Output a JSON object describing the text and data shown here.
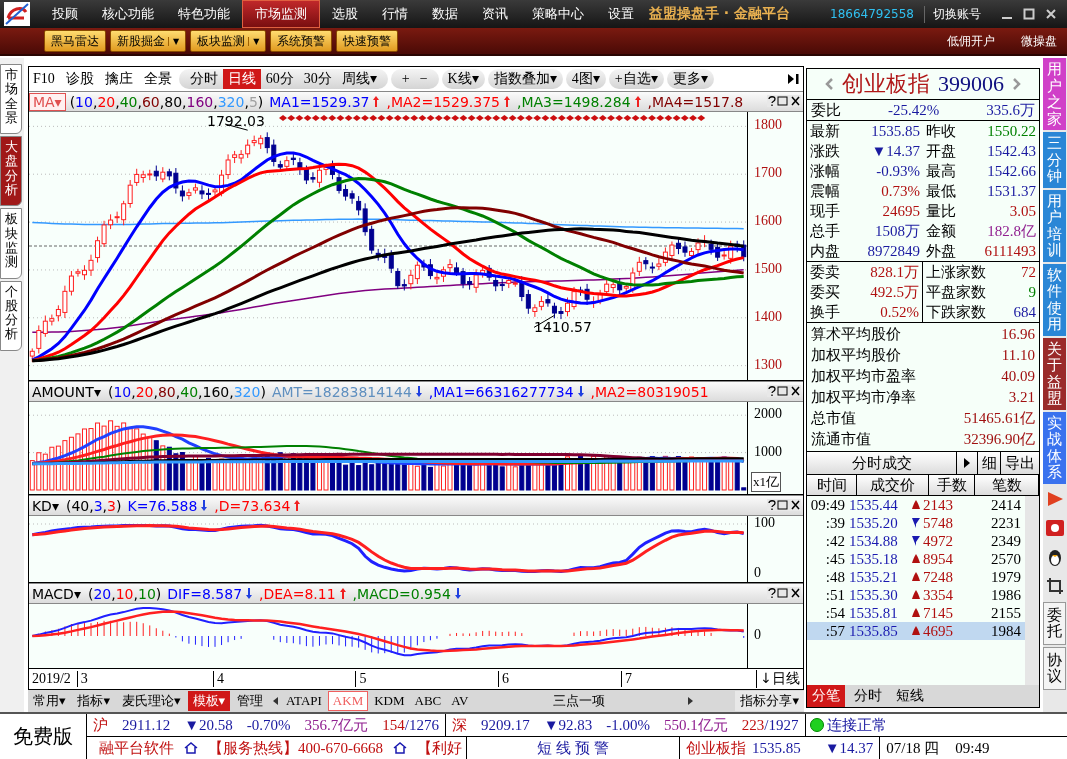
{
  "menu": {
    "items": [
      {
        "label": "投顾",
        "selected": false
      },
      {
        "label": "核心功能",
        "selected": false
      },
      {
        "label": "特色功能",
        "selected": false
      },
      {
        "label": "市场监测",
        "selected": true
      },
      {
        "label": "选股",
        "selected": false
      },
      {
        "label": "行情",
        "selected": false
      },
      {
        "label": "数据",
        "selected": false
      },
      {
        "label": "资讯",
        "selected": false
      },
      {
        "label": "策略中心",
        "selected": false
      },
      {
        "label": "设置",
        "selected": false
      }
    ],
    "brand": "益盟操盘手 · 金融平台",
    "phone": "18664792558",
    "switch_account": "切换账号"
  },
  "toolbar": {
    "buttons": [
      {
        "label": "黑马雷达"
      },
      {
        "label": "新股掘金",
        "caret": "▼"
      },
      {
        "label": "板块监测",
        "caret": "▼"
      },
      {
        "label": "系统预警"
      },
      {
        "label": "快速预警"
      }
    ],
    "links": [
      "低佣开户",
      "微操盘"
    ]
  },
  "left_tabs": [
    {
      "label": "市场全景",
      "selected": false
    },
    {
      "label": "大盘分析",
      "selected": true
    },
    {
      "label": "板块监测",
      "selected": false
    },
    {
      "label": "个股分析",
      "selected": false
    }
  ],
  "chart_toolbar": {
    "tools": [
      "F10",
      "诊股",
      "擒庄",
      "全景"
    ],
    "periods": [
      {
        "label": "分时",
        "selected": false
      },
      {
        "label": "日线",
        "selected": true
      },
      {
        "label": "60分",
        "selected": false
      },
      {
        "label": "30分",
        "selected": false
      },
      {
        "label": "周线",
        "selected": false,
        "caret": "▾"
      }
    ],
    "zoom": [
      "+",
      "−"
    ],
    "menus": [
      {
        "label": "K线",
        "caret": "▾"
      },
      {
        "label": "指数叠加",
        "caret": "▾"
      },
      {
        "label": "4图",
        "caret": "▾"
      },
      {
        "label": "+自选",
        "caret": "▾"
      },
      {
        "label": "更多",
        "caret": "▾"
      }
    ]
  },
  "panes": [
    {
      "kind": "price",
      "name": "MA",
      "caret": "▾",
      "open": "(",
      "sep": ",",
      "close": ")",
      "params": [
        {
          "text": "10",
          "color": "#0000ff"
        },
        {
          "text": "20",
          "color": "#ff0000"
        },
        {
          "text": "40",
          "color": "#008000"
        },
        {
          "text": "60",
          "color": "#800000"
        },
        {
          "text": "80",
          "color": "#000000"
        },
        {
          "text": "160",
          "color": "#800080"
        },
        {
          "text": "320",
          "color": "#3399ff"
        },
        {
          "text": "5",
          "color": "#a0a0a0"
        }
      ],
      "values": [
        {
          "text": "MA1=1529.37",
          "color": "#0000ff",
          "rising": true
        },
        {
          "text": ",MA2=1529.375",
          "color": "#ff0000",
          "rising": true
        },
        {
          "text": ",MA3=1498.284",
          "color": "#008000",
          "rising": true
        },
        {
          "text": ",MA4=1517.8",
          "color": "#800000"
        }
      ],
      "axis": [
        "1800",
        "1700",
        "1600",
        "1500",
        "1400",
        "1300"
      ],
      "high_label": "1792.03",
      "low_label": "1410.57"
    },
    {
      "kind": "amount",
      "name": "AMOUNT",
      "caret": "▾",
      "open": "(",
      "sep": ",",
      "close": ")",
      "params": [
        {
          "text": "10",
          "color": "#0000ff"
        },
        {
          "text": "20",
          "color": "#ff0000"
        },
        {
          "text": "80",
          "color": "#800000"
        },
        {
          "text": "40",
          "color": "#008000"
        },
        {
          "text": "160",
          "color": "#000000"
        },
        {
          "text": "320",
          "color": "#3399ff"
        }
      ],
      "values": [
        {
          "text": "AMT=18283814144",
          "color": "#5f8fbf",
          "rising": false
        },
        {
          "text": ",MA1=66316277734",
          "color": "#0000ff",
          "rising": false
        },
        {
          "text": ",MA2=80319051",
          "color": "#ff0000"
        }
      ],
      "axis": [
        "2000",
        "1000"
      ],
      "unit": "x1亿"
    },
    {
      "kind": "kd",
      "name": "KD",
      "caret": "▾",
      "open": "(",
      "sep": ",",
      "close": ")",
      "params": [
        {
          "text": "40",
          "color": "#000000"
        },
        {
          "text": "3",
          "color": "#0000ff"
        },
        {
          "text": "3",
          "color": "#ff0000"
        }
      ],
      "values": [
        {
          "text": "K=76.588",
          "color": "#0000ff",
          "rising": false
        },
        {
          "text": ",D=73.634",
          "color": "#ff0000",
          "rising": true
        }
      ],
      "axis": [
        "100",
        "0"
      ]
    },
    {
      "kind": "macd",
      "name": "MACD",
      "caret": "▾",
      "open": "(",
      "sep": ",",
      "close": ")",
      "params": [
        {
          "text": "20",
          "color": "#0000ff"
        },
        {
          "text": "10",
          "color": "#ff0000"
        },
        {
          "text": "10",
          "color": "#008000"
        }
      ],
      "values": [
        {
          "text": "DIF=8.587",
          "color": "#0000ff",
          "rising": false
        },
        {
          "text": ",DEA=8.11",
          "color": "#ff0000",
          "rising": true
        },
        {
          "text": ",MACD=0.954",
          "color": "#008000",
          "rising": false
        }
      ],
      "axis": [
        "0"
      ]
    }
  ],
  "dates": [
    "2019/2",
    "3",
    "4",
    "5",
    "6",
    "7"
  ],
  "period_label": "↓日线",
  "bottom_tabs": [
    {
      "label": "常用",
      "caret": "▾",
      "selected": false
    },
    {
      "label": "指标",
      "caret": "▾",
      "selected": false
    },
    {
      "label": "麦氏理论",
      "caret": "▾",
      "selected": false
    },
    {
      "label": "模板",
      "caret": "▾",
      "selected": true
    },
    {
      "label": "管理",
      "selected": false
    }
  ],
  "indicator_tabs": [
    {
      "label": "ATAPI",
      "selected": false
    },
    {
      "label": "AKM",
      "selected": true
    },
    {
      "label": "KDM",
      "selected": false
    },
    {
      "label": "ABC",
      "selected": false
    },
    {
      "label": "AV",
      "selected": false
    }
  ],
  "indicator_center": "三点一项",
  "indicator_share": {
    "label": "指标分享",
    "caret": "▾"
  },
  "quote": {
    "name": "创业板指",
    "code": "399006",
    "ratio_label": "委比",
    "ratio": "-25.42%",
    "ratio_amount": "335.6万",
    "grid": [
      {
        "label": "最新",
        "value": "1535.85",
        "color": "#1a1aa0"
      },
      {
        "label": "昨收",
        "value": "1550.22",
        "color": "#008000"
      },
      {
        "label": "涨跌",
        "value": "▼14.37",
        "color": "#1a1aa0"
      },
      {
        "label": "开盘",
        "value": "1542.43",
        "color": "#1a1aa0"
      },
      {
        "label": "涨幅",
        "value": "-0.93%",
        "color": "#1a1aa0"
      },
      {
        "label": "最高",
        "value": "1542.66",
        "color": "#1a1aa0"
      },
      {
        "label": "震幅",
        "value": "0.73%",
        "color": "#b01010"
      },
      {
        "label": "最低",
        "value": "1531.37",
        "color": "#1a1aa0"
      },
      {
        "label": "现手",
        "value": "24695",
        "color": "#b01010"
      },
      {
        "label": "量比",
        "value": "3.05",
        "color": "#b01010"
      },
      {
        "label": "总手",
        "value": "1508万",
        "color": "#1a1aa0"
      },
      {
        "label": "金额",
        "value": "182.8亿",
        "color": "#902090"
      },
      {
        "label": "内盘",
        "value": "8972849",
        "color": "#1a1aa0"
      },
      {
        "label": "外盘",
        "value": "6111493",
        "color": "#b01010"
      }
    ],
    "orders": [
      {
        "label": "委卖",
        "value": "828.1万",
        "color": "#b01010"
      },
      {
        "label": "委买",
        "value": "492.5万",
        "color": "#b01010"
      },
      {
        "label": "换手",
        "value": "0.52%",
        "color": "#b01010"
      }
    ],
    "breadth": [
      {
        "label": "上涨家数",
        "value": "72",
        "color": "#b01010"
      },
      {
        "label": "平盘家数",
        "value": "9",
        "color": "#008000"
      },
      {
        "label": "下跌家数",
        "value": "684",
        "color": "#1a1aa0"
      }
    ],
    "stats": [
      {
        "label": "算术平均股价",
        "value": "16.96"
      },
      {
        "label": "加权平均股价",
        "value": "11.10"
      },
      {
        "label": "加权平均市盈率",
        "value": "40.09"
      },
      {
        "label": "加权平均市净率",
        "value": "3.21"
      },
      {
        "label": "总市值",
        "value": "51465.61亿"
      },
      {
        "label": "流通市值",
        "value": "32396.90亿"
      }
    ]
  },
  "trades": {
    "title": "分时成交",
    "buttons": [
      "细",
      "导出"
    ],
    "columns": [
      "时间",
      "成交价",
      "手数",
      "笔数"
    ],
    "rows": [
      {
        "time": "09:49",
        "price": "1535.44",
        "rising": true,
        "volume": "2143",
        "count": "2414",
        "selected": false
      },
      {
        "time": ":39",
        "price": "1535.20",
        "rising": false,
        "volume": "5748",
        "count": "2231",
        "selected": false
      },
      {
        "time": ":42",
        "price": "1534.88",
        "rising": false,
        "volume": "4972",
        "count": "2349",
        "selected": false
      },
      {
        "time": ":45",
        "price": "1535.18",
        "rising": true,
        "volume": "8954",
        "count": "2570",
        "selected": false
      },
      {
        "time": ":48",
        "price": "1535.21",
        "rising": true,
        "volume": "7248",
        "count": "1979",
        "selected": false
      },
      {
        "time": ":51",
        "price": "1535.30",
        "rising": true,
        "volume": "3354",
        "count": "1986",
        "selected": false
      },
      {
        "time": ":54",
        "price": "1535.81",
        "rising": true,
        "volume": "7145",
        "count": "2155",
        "selected": false
      },
      {
        "time": ":57",
        "price": "1535.85",
        "rising": true,
        "volume": "4695",
        "count": "1984",
        "selected": true
      }
    ],
    "tabs": [
      {
        "label": "分笔",
        "selected": true
      },
      {
        "label": "分时",
        "selected": false
      },
      {
        "label": "短线",
        "selected": false
      }
    ]
  },
  "side_links": [
    {
      "label": "用户之家",
      "color": "#d040c8"
    },
    {
      "label": "三分钟",
      "color": "#2a86d6"
    },
    {
      "label": "用户培训",
      "color": "#2a86d6"
    },
    {
      "label": "软件使用",
      "color": "#2a86d6"
    },
    {
      "label": "关于益盟",
      "color": "#9a2a2a"
    },
    {
      "label": "实战体系",
      "color": "#3a72ee"
    }
  ],
  "side_buttons": [
    "委托",
    "协议"
  ],
  "status": {
    "edition": "免费版",
    "markets": [
      {
        "name": "沪",
        "price": "2911.12",
        "change": "▼20.58",
        "pct": "-0.70%",
        "amount": "356.7亿元",
        "up": "154",
        "total": "/1276"
      },
      {
        "name": "深",
        "price": "9209.17",
        "change": "▼92.83",
        "pct": "-1.00%",
        "amount": "550.1亿元",
        "up": "223",
        "total": "/1927"
      }
    ],
    "connection": "连接正常",
    "ticker": "融平台软件",
    "hotline": "【服务热线】400-670-6668",
    "news": "【利好",
    "alert": "短 线 预 警",
    "index_name": "创业板指",
    "index_price": "1535.85",
    "index_change": "▼14.37",
    "date": "07/18 四",
    "time": "09:49"
  }
}
